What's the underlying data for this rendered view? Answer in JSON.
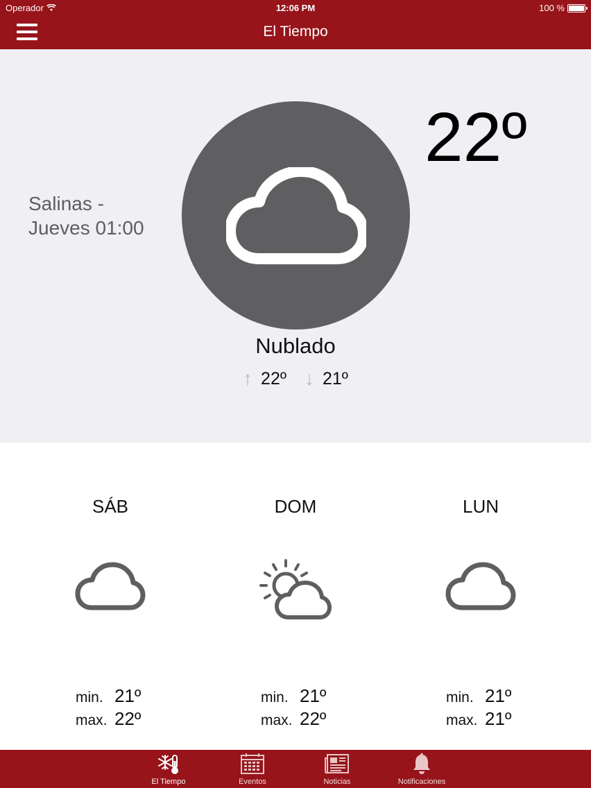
{
  "status_bar": {
    "carrier": "Operador",
    "time": "12:06 PM",
    "battery": "100 %",
    "battery_level": 1.0
  },
  "nav": {
    "title": "El Tiempo",
    "menu_icon": "hamburger-menu-icon"
  },
  "current": {
    "location_line1": "Salinas -",
    "location_line2": "Jueves 01:00",
    "temperature": "22º",
    "condition": "Nublado",
    "high": "22º",
    "low": "21º",
    "icon": "cloud-icon"
  },
  "forecast": [
    {
      "day": "SÁB",
      "icon": "cloud-icon",
      "min_label": "min.",
      "min": "21º",
      "max_label": "max.",
      "max": "22º"
    },
    {
      "day": "DOM",
      "icon": "partly-cloudy-icon",
      "min_label": "min.",
      "min": "21º",
      "max_label": "max.",
      "max": "22º"
    },
    {
      "day": "LUN",
      "icon": "cloud-icon",
      "min_label": "min.",
      "min": "21º",
      "max_label": "max.",
      "max": "21º"
    }
  ],
  "tabs": [
    {
      "label": "El Tiempo",
      "icon": "weather-thermometer-icon",
      "active": true
    },
    {
      "label": "Eventos",
      "icon": "calendar-icon",
      "active": false
    },
    {
      "label": "Noticias",
      "icon": "newspaper-icon",
      "active": false
    },
    {
      "label": "Notificaciones",
      "icon": "bell-icon",
      "active": false
    }
  ],
  "colors": {
    "brand": "#96141a",
    "panel": "#efeff4",
    "circle": "#5f5e61",
    "icon_gray": "#5f5e61"
  }
}
